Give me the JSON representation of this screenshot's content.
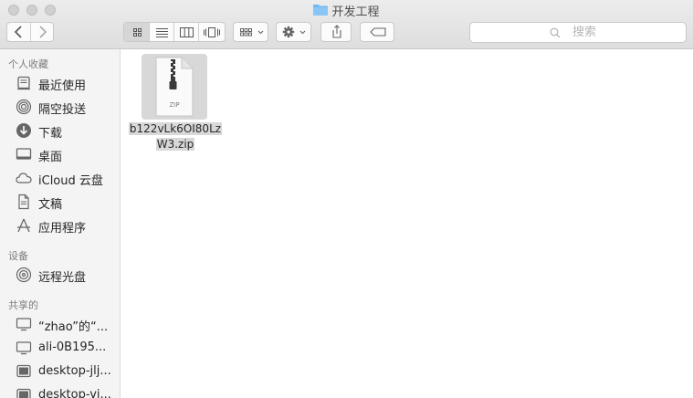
{
  "window": {
    "title": "开发工程"
  },
  "toolbar": {
    "back_icon": "chevron-left-icon",
    "forward_icon": "chevron-right-icon",
    "view_modes": [
      "icon-view",
      "list-view",
      "column-view",
      "cover-flow-view"
    ],
    "active_view": "icon-view",
    "group_icon": "grid-group-icon",
    "action_icon": "gear-icon",
    "share_icon": "share-icon",
    "tag_icon": "tag-icon",
    "search_placeholder": "搜索"
  },
  "sidebar": {
    "favorites_title": "个人收藏",
    "favorites": [
      {
        "label": "最近使用",
        "icon": "recents-icon"
      },
      {
        "label": "隔空投送",
        "icon": "airdrop-icon"
      },
      {
        "label": "下载",
        "icon": "downloads-icon"
      },
      {
        "label": "桌面",
        "icon": "desktop-icon"
      },
      {
        "label": "iCloud 云盘",
        "icon": "icloud-icon"
      },
      {
        "label": "文稿",
        "icon": "documents-icon"
      },
      {
        "label": "应用程序",
        "icon": "applications-icon"
      }
    ],
    "devices_title": "设备",
    "devices": [
      {
        "label": "远程光盘",
        "icon": "remote-disc-icon"
      }
    ],
    "shared_title": "共享的",
    "shared": [
      {
        "label": "“zhao”的“...",
        "icon": "computer-icon"
      },
      {
        "label": "ali-0B195...",
        "icon": "computer-icon"
      },
      {
        "label": "desktop-jlj...",
        "icon": "computer-icon"
      },
      {
        "label": "desktop-vi...",
        "icon": "computer-icon"
      }
    ]
  },
  "main": {
    "files": [
      {
        "name_line1": "b122vLk6OI80Lz",
        "name_line2": "W3.zip",
        "badge": "ZIP",
        "icon": "zip-file-icon",
        "selected": true
      }
    ]
  },
  "colors": {
    "folder_blue": "#6fb8f2",
    "selection_gray": "#d8d8d8",
    "sidebar_bg": "#f4f4f4"
  }
}
